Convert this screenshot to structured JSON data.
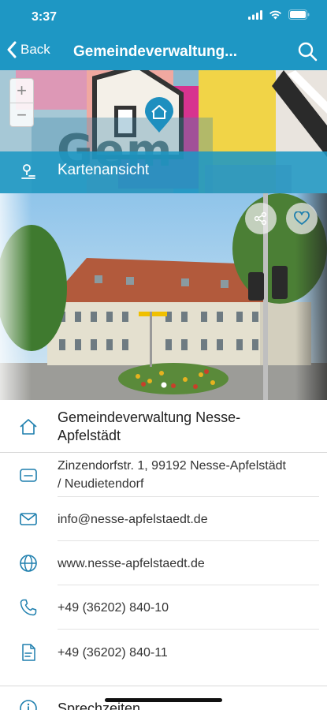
{
  "status": {
    "time": "3:37"
  },
  "nav": {
    "back_label": "Back",
    "title": "Gemeindeverwaltung..."
  },
  "map": {
    "label": "Kartenansicht",
    "zoom_in": "+",
    "zoom_out": "−",
    "sign_text": "Gem"
  },
  "photo": {
    "alt": "Gebäude der Gemeindeverwaltung"
  },
  "details": {
    "name": "Gemeindeverwaltung Nesse-Apfelstädt",
    "name_line1": "Gemeindeverwaltung Nesse-",
    "name_line2": "Apfelstädt",
    "address_line1": "Zinzendorfstr. 1, 99192 Nesse-Apfelstädt",
    "address_line2": "/ Neudietendorf",
    "email": "info@nesse-apfelstaedt.de",
    "website": "www.nesse-apfelstaedt.de",
    "phone": "+49 (36202) 840-10",
    "fax": "+49 (36202) 840-11"
  },
  "sections": {
    "office_hours": "Sprechzeiten"
  },
  "colors": {
    "accent": "#1e97c4",
    "icon": "#1e7fae"
  }
}
